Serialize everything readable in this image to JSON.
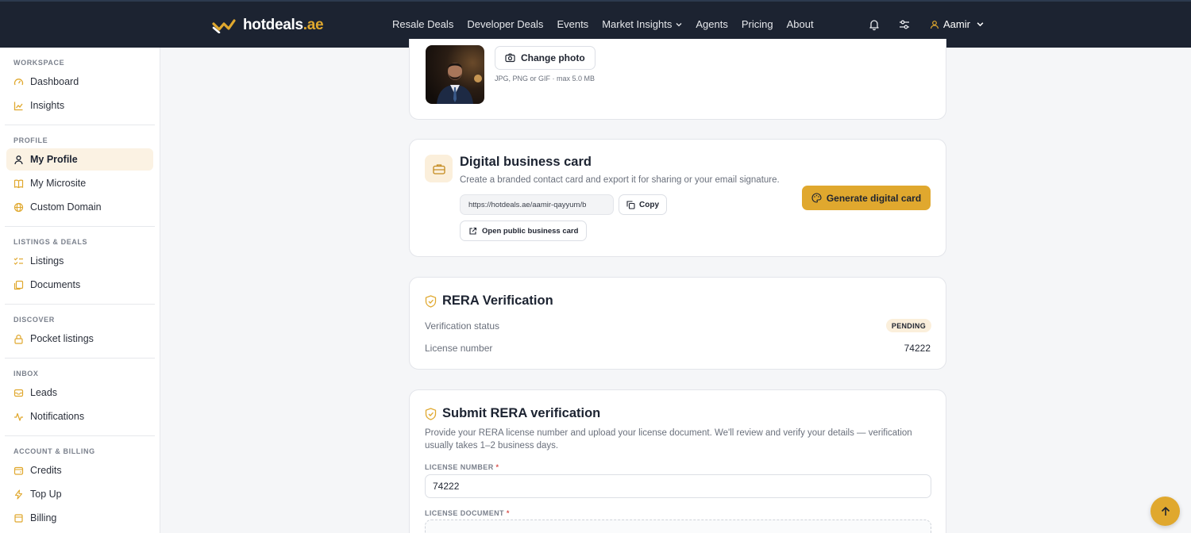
{
  "brand": {
    "name": "hotdeals",
    "tld": ".ae",
    "accent": "#e0a82e",
    "nav_bg": "#1c2331"
  },
  "nav": {
    "links": [
      "Resale Deals",
      "Developer Deals",
      "Events",
      "Market Insights",
      "Agents",
      "Pricing",
      "About"
    ],
    "user_name": "Aamir"
  },
  "sidebar": {
    "workspace": {
      "title": "WORKSPACE",
      "items": [
        "Dashboard",
        "Insights"
      ]
    },
    "profile": {
      "title": "PROFILE",
      "items": [
        "My Profile",
        "My Microsite",
        "Custom Domain"
      ]
    },
    "listings": {
      "title": "LISTINGS & DEALS",
      "items": [
        "Listings",
        "Documents"
      ]
    },
    "discover": {
      "title": "DISCOVER",
      "items": [
        "Pocket listings"
      ]
    },
    "inbox": {
      "title": "INBOX",
      "items": [
        "Leads",
        "Notifications"
      ]
    },
    "billing": {
      "title": "ACCOUNT & BILLING",
      "items": [
        "Credits",
        "Top Up",
        "Billing"
      ]
    }
  },
  "photo_card": {
    "change_label": "Change photo",
    "note": "JPG, PNG or GIF · max 5.0 MB"
  },
  "business_card": {
    "title": "Digital business card",
    "description": "Create a branded contact card and export it for sharing or your email signature.",
    "url": "https://hotdeals.ae/aamir-qayyum/b",
    "copy_label": "Copy",
    "open_label": "Open public business card",
    "generate_label": "Generate digital card"
  },
  "rera": {
    "title": "RERA Verification",
    "status_label": "Verification status",
    "status_value": "PENDING",
    "license_label": "License number",
    "license_value": "74222"
  },
  "submit": {
    "title": "Submit RERA verification",
    "description": "Provide your RERA license number and upload your license document. We'll review and verify your details — verification usually takes 1–2 business days.",
    "license_field_label": "LICENSE NUMBER",
    "license_field_value": "74222",
    "document_field_label": "LICENSE DOCUMENT",
    "required_mark": "*"
  }
}
